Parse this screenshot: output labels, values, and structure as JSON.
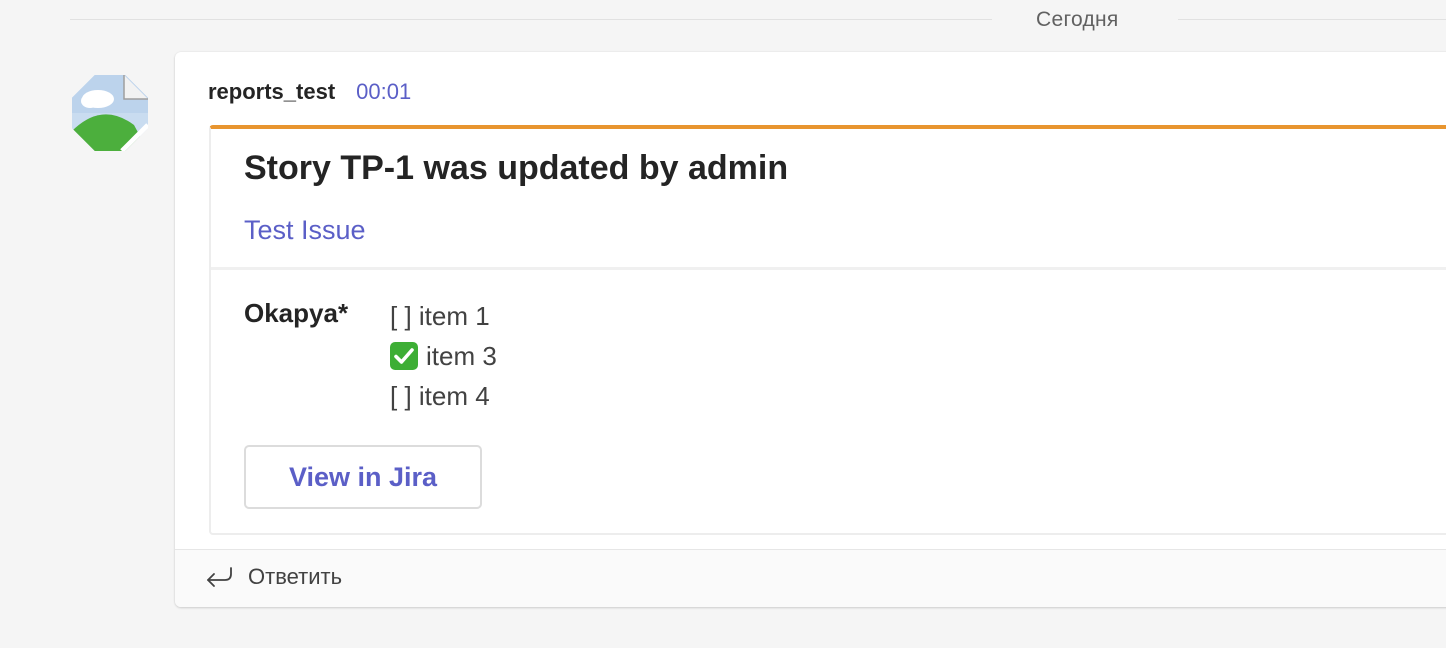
{
  "divider": {
    "label": "Сегодня"
  },
  "message": {
    "sender": "reports_test",
    "time": "00:01",
    "avatar_icon": "broken-image-icon"
  },
  "card": {
    "accent_color": "#e8952f",
    "title": "Story TP-1 was updated by admin",
    "link_label": "Test Issue",
    "fact": {
      "label": "Okapya*",
      "items": [
        {
          "checked": false,
          "prefix": "[ ]",
          "text": "item 1"
        },
        {
          "checked": true,
          "prefix": "",
          "icon": "check-mark-button-icon",
          "text": "item 3"
        },
        {
          "checked": false,
          "prefix": "[ ]",
          "text": "item 4"
        }
      ]
    },
    "button_label": "View in Jira"
  },
  "reply": {
    "label": "Ответить",
    "icon": "reply-arrow-icon"
  },
  "colors": {
    "link": "#5b5fc7",
    "text": "#242424",
    "background": "#f5f5f5"
  }
}
